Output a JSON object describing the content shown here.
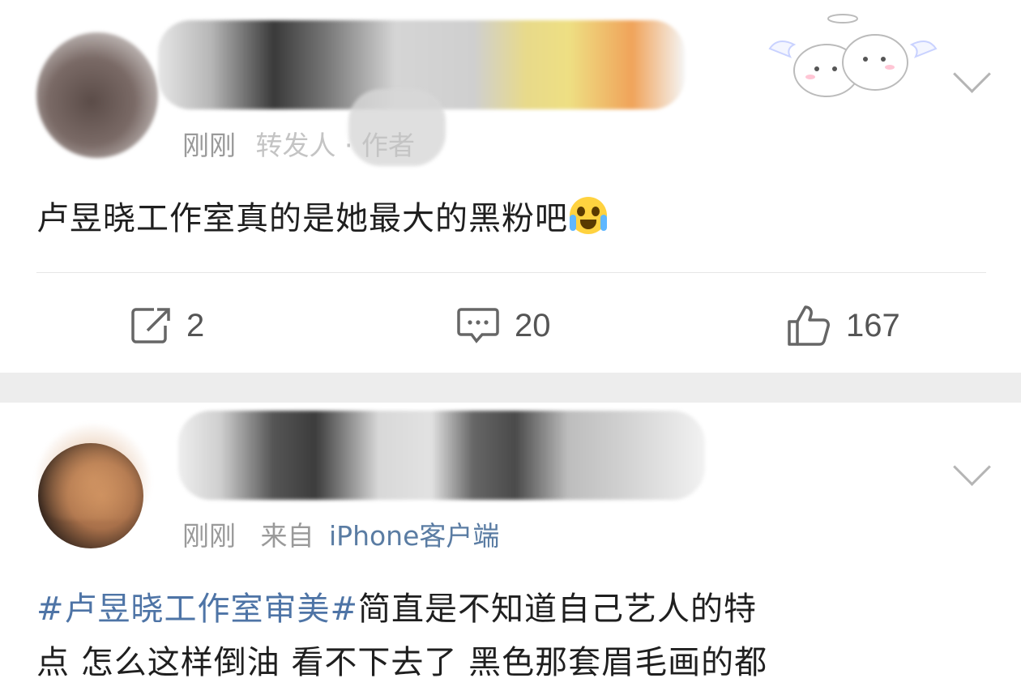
{
  "post1": {
    "time": "刚刚",
    "meta_rest": "转发人 · 作者",
    "content": "卢昱晓工作室真的是她最大的黑粉吧",
    "emoji": "loudly-crying-face",
    "actions": {
      "repost_count": "2",
      "comment_count": "20",
      "like_count": "167"
    }
  },
  "post2": {
    "time": "刚刚",
    "from_prefix": "来自",
    "source": "iPhone客户端",
    "hashtag": "#卢昱晓工作室审美#",
    "line1_rest": "简直是不知道自己艺人的特",
    "line2": "点 怎么这样倒油 看不下去了 黑色那套眉毛画的都"
  },
  "colors": {
    "link": "#4e74a6",
    "meta": "#9a9a9a",
    "background": "#ededed"
  },
  "icons": [
    "repost-icon",
    "comment-icon",
    "like-icon",
    "chevron-down-icon",
    "loudly-crying-face"
  ]
}
